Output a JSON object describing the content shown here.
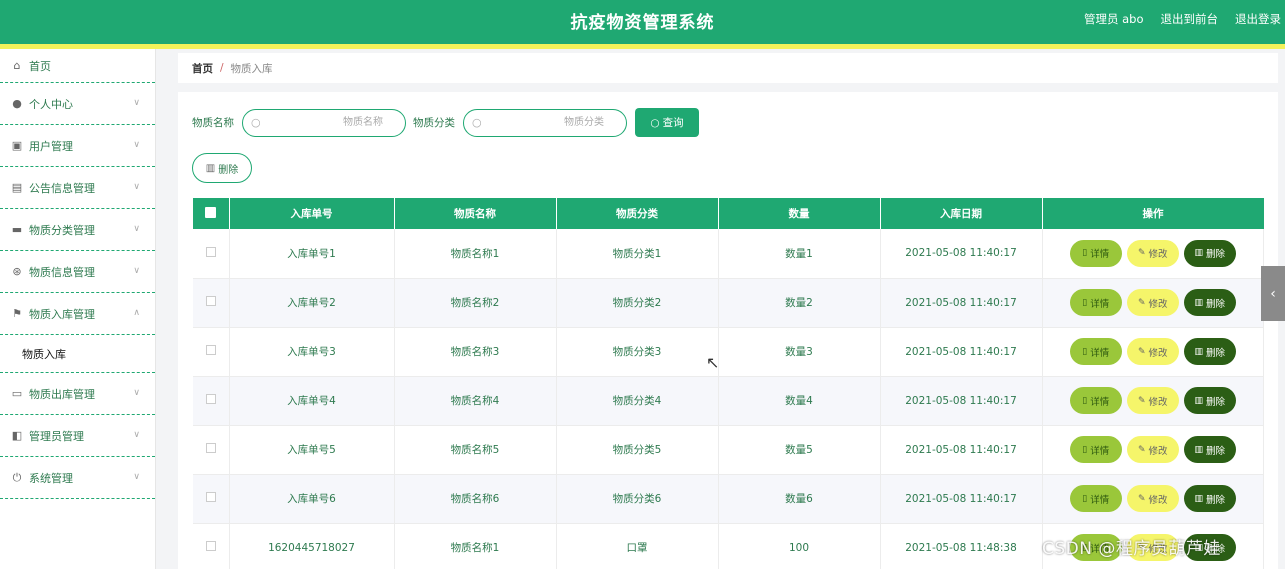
{
  "header": {
    "title": "抗疫物资管理系统",
    "user": "管理员 abo",
    "to_front": "退出到前台",
    "logout": "退出登录"
  },
  "sidebar": {
    "items": [
      {
        "label": "首页",
        "icon": "home-icon"
      },
      {
        "label": "个人中心",
        "icon": "user-icon"
      },
      {
        "label": "用户管理",
        "icon": "users-icon"
      },
      {
        "label": "公告信息管理",
        "icon": "notice-icon"
      },
      {
        "label": "物质分类管理",
        "icon": "category-icon"
      },
      {
        "label": "物质信息管理",
        "icon": "info-icon"
      },
      {
        "label": "物质入库管理",
        "icon": "flag-icon",
        "sub": "物质入库"
      },
      {
        "label": "物质出库管理",
        "icon": "chat-icon"
      },
      {
        "label": "管理员管理",
        "icon": "admin-icon"
      },
      {
        "label": "系统管理",
        "icon": "power-icon"
      }
    ]
  },
  "breadcrumb": {
    "home": "首页",
    "sep": "/",
    "current": "物质入库"
  },
  "search": {
    "name_label": "物质名称",
    "name_placeholder": "物质名称",
    "category_label": "物质分类",
    "category_placeholder": "物质分类",
    "query_label": "查询"
  },
  "toolbar": {
    "delete_label": "删除"
  },
  "table": {
    "columns": [
      "入库单号",
      "物质名称",
      "物质分类",
      "数量",
      "入库日期",
      "操作"
    ],
    "rows": [
      [
        "入库单号1",
        "物质名称1",
        "物质分类1",
        "数量1",
        "2021-05-08 11:40:17"
      ],
      [
        "入库单号2",
        "物质名称2",
        "物质分类2",
        "数量2",
        "2021-05-08 11:40:17"
      ],
      [
        "入库单号3",
        "物质名称3",
        "物质分类3",
        "数量3",
        "2021-05-08 11:40:17"
      ],
      [
        "入库单号4",
        "物质名称4",
        "物质分类4",
        "数量4",
        "2021-05-08 11:40:17"
      ],
      [
        "入库单号5",
        "物质名称5",
        "物质分类5",
        "数量5",
        "2021-05-08 11:40:17"
      ],
      [
        "入库单号6",
        "物质名称6",
        "物质分类6",
        "数量6",
        "2021-05-08 11:40:17"
      ],
      [
        "1620445718027",
        "物质名称1",
        "口罩",
        "100",
        "2021-05-08 11:48:38"
      ]
    ],
    "actions": {
      "detail": "详情",
      "edit": "修改",
      "delete": "删除"
    }
  },
  "watermark": "CSDN @程序员葫芦娃",
  "colors": {
    "primary": "#1fa872",
    "accent_strip": "#f2f25a",
    "detail": "#9ac73a",
    "edit": "#f5f56a",
    "delete": "#2b5e15"
  }
}
